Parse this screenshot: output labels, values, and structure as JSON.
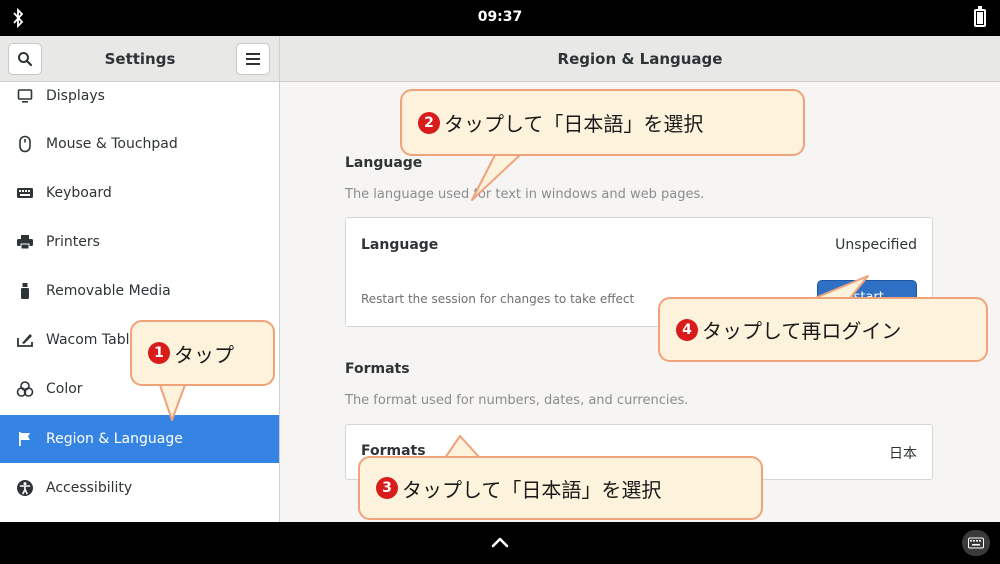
{
  "status_bar": {
    "time": "09:37",
    "bluetooth_icon": "bluetooth-icon",
    "battery_icon": "battery-icon"
  },
  "sidebar": {
    "title": "Settings",
    "items": [
      {
        "label": "Displays",
        "icon": "display-icon"
      },
      {
        "label": "Mouse & Touchpad",
        "icon": "mouse-icon"
      },
      {
        "label": "Keyboard",
        "icon": "keyboard-icon"
      },
      {
        "label": "Printers",
        "icon": "printer-icon"
      },
      {
        "label": "Removable Media",
        "icon": "usb-icon"
      },
      {
        "label": "Wacom Tablet",
        "icon": "wacom-icon"
      },
      {
        "label": "Color",
        "icon": "color-icon"
      },
      {
        "label": "Region & Language",
        "icon": "flag-icon",
        "selected": true
      },
      {
        "label": "Accessibility",
        "icon": "accessibility-icon"
      }
    ]
  },
  "main": {
    "title": "Region & Language",
    "language": {
      "title": "Language",
      "description": "The language used for text in windows and web pages.",
      "row_label": "Language",
      "row_value": "Unspecified",
      "restart_text": "Restart the session for changes to take effect",
      "restart_button": "Restart…"
    },
    "formats": {
      "title": "Formats",
      "description": "The format used for numbers, dates, and currencies.",
      "row_label": "Formats",
      "row_value": "日本"
    }
  },
  "callouts": [
    {
      "number": "1",
      "text": "タップ"
    },
    {
      "number": "2",
      "text": "タップして「日本語」を選択"
    },
    {
      "number": "3",
      "text": "タップして「日本語」を選択"
    },
    {
      "number": "4",
      "text": "タップして再ログイン"
    }
  ],
  "colors": {
    "selected": "#3584e4",
    "restart_button": "#2f6fc4",
    "callout_fill": "#fdf3dc",
    "callout_border": "#f0a27a",
    "callout_number": "#d81b1b"
  }
}
